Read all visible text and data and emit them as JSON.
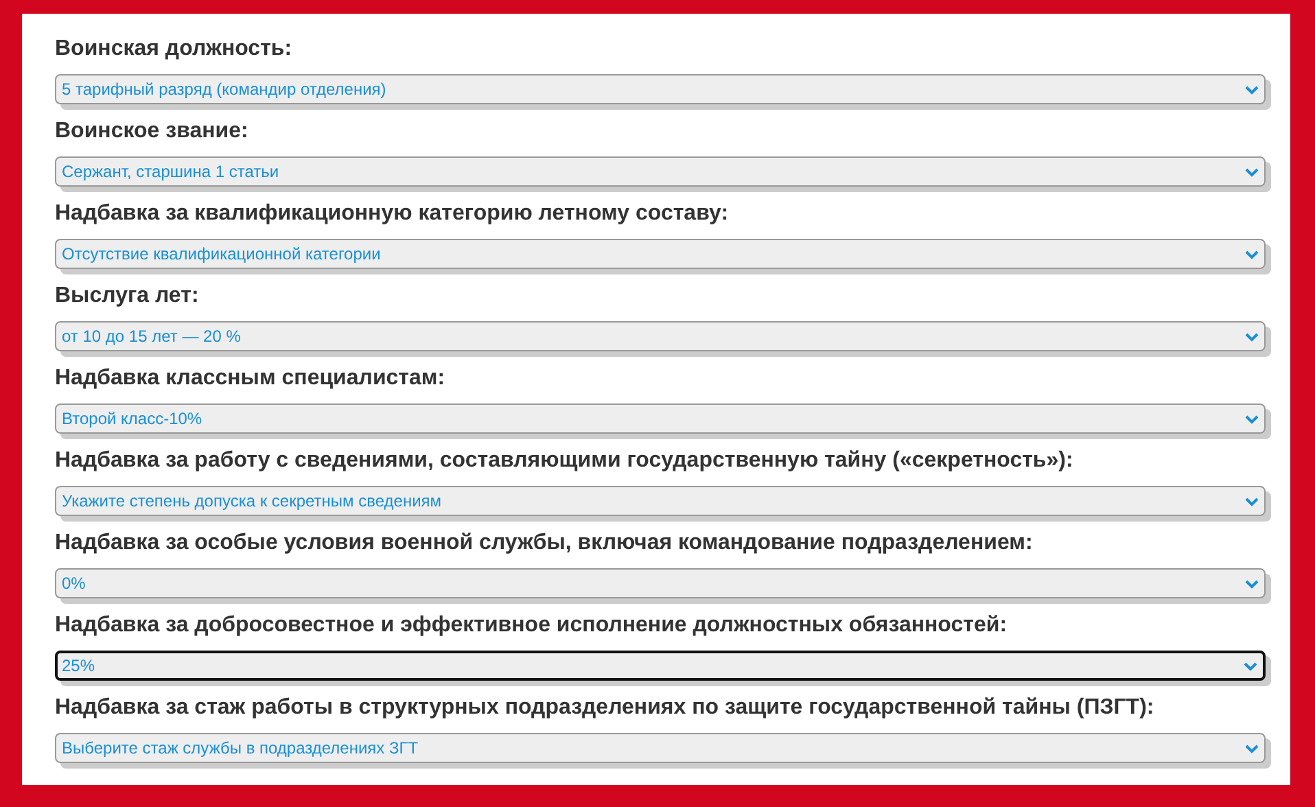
{
  "fields": [
    {
      "label": "Воинская должность:",
      "value": "5 тарифный разряд (командир отделения)",
      "focused": false
    },
    {
      "label": "Воинское звание:",
      "value": "Сержант, старшина 1 статьи",
      "focused": false
    },
    {
      "label": "Надбавка за квалификационную категорию летному составу:",
      "value": "Отсутствие квалификационной категории",
      "focused": false
    },
    {
      "label": "Выслуга лет:",
      "value": "от 10 до 15 лет — 20 %",
      "focused": false
    },
    {
      "label": "Надбавка классным специалистам:",
      "value": "Второй класс-10%",
      "focused": false
    },
    {
      "label": "Надбавка за работу с сведениями, составляющими государственную тайну («секретность»):",
      "value": "Укажите степень допуска к секретным сведениям",
      "focused": false
    },
    {
      "label": "Надбавка за особые условия военной службы, включая командование подразделением:",
      "value": "0%",
      "focused": false
    },
    {
      "label": "Надбавка за добросовестное и эффективное исполнение должностных обязанностей:",
      "value": "25%",
      "focused": true
    },
    {
      "label": "Надбавка за стаж работы в структурных подразделениях по защите государственной тайны (ПЗГТ):",
      "value": "Выберите стаж службы в подразделениях ЗГТ",
      "focused": false
    }
  ]
}
